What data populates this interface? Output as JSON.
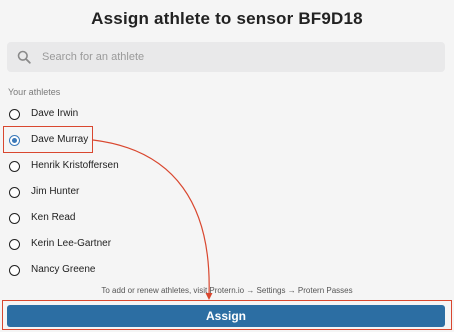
{
  "title": "Assign athlete to sensor BF9D18",
  "search": {
    "placeholder": "Search for an athlete",
    "value": ""
  },
  "athletes_section": {
    "label": "Your athletes",
    "items": [
      {
        "name": "Dave Irwin",
        "selected": false
      },
      {
        "name": "Dave Murray",
        "selected": true
      },
      {
        "name": "Henrik Kristoffersen",
        "selected": false
      },
      {
        "name": "Jim Hunter",
        "selected": false
      },
      {
        "name": "Ken Read",
        "selected": false
      },
      {
        "name": "Kerin Lee-Gartner",
        "selected": false
      },
      {
        "name": "Nancy Greene",
        "selected": false
      }
    ]
  },
  "hint": "To add or renew athletes, visit Protern.io → Settings → Protern Passes",
  "assign_button": {
    "label": "Assign"
  },
  "colors": {
    "accent": "#2c6ea3",
    "annotation": "#d9472f",
    "radio_selected": "#3a78b8"
  }
}
